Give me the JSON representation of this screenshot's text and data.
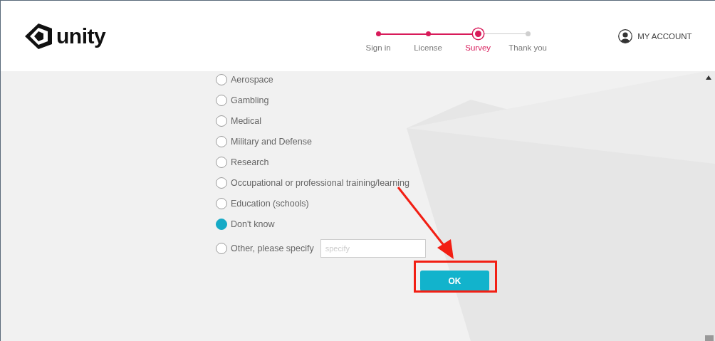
{
  "logo": {
    "text": "unity"
  },
  "steps": [
    {
      "label": "Sign in",
      "done": true,
      "selected": false
    },
    {
      "label": "License",
      "done": true,
      "selected": false
    },
    {
      "label": "Survey",
      "done": true,
      "selected": true
    },
    {
      "label": "Thank you",
      "done": false,
      "selected": false
    }
  ],
  "account": {
    "label": "MY ACCOUNT"
  },
  "options": [
    {
      "kind": "plain",
      "label": "Aerospace",
      "selected": false
    },
    {
      "kind": "plain",
      "label": "Gambling",
      "selected": false
    },
    {
      "kind": "plain",
      "label": "Medical",
      "selected": false
    },
    {
      "kind": "plain",
      "label": "Military and Defense",
      "selected": false
    },
    {
      "kind": "plain",
      "label": "Research",
      "selected": false
    },
    {
      "kind": "plain",
      "label": "Occupational or professional training/learning",
      "selected": false
    },
    {
      "kind": "plain",
      "label": "Education (schools)",
      "selected": false
    },
    {
      "kind": "plain",
      "label": "Don't know",
      "selected": true
    },
    {
      "kind": "with-field",
      "label": "Other, please specify",
      "selected": false,
      "placeholder": "specify"
    }
  ],
  "ok_button": {
    "label": "OK"
  }
}
